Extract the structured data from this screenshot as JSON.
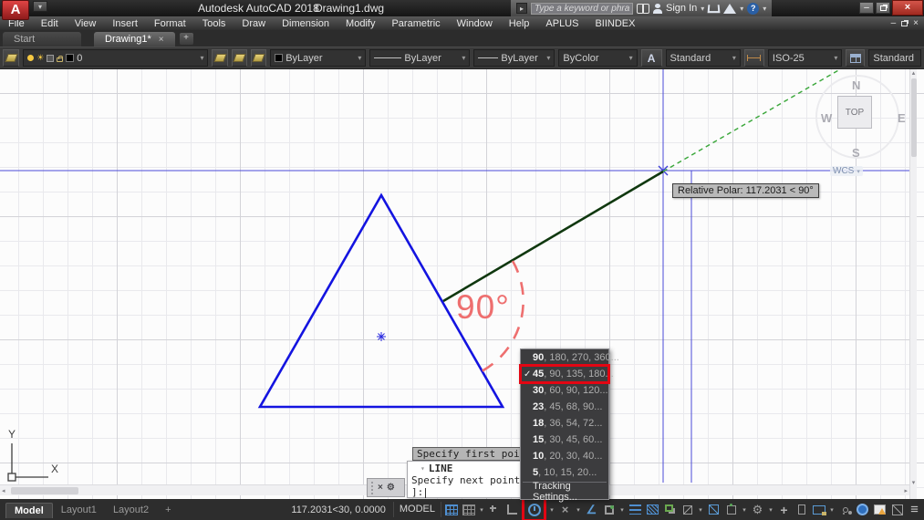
{
  "titlebar": {
    "app_initial": "A",
    "title_app": "Autodesk AutoCAD 2018",
    "title_doc": "Drawing1.dwg",
    "search_placeholder": "Type a keyword or phrase",
    "sign_in_label": "Sign In"
  },
  "menubar": {
    "items": [
      "File",
      "Edit",
      "View",
      "Insert",
      "Format",
      "Tools",
      "Draw",
      "Dimension",
      "Modify",
      "Parametric",
      "Window",
      "Help",
      "APLUS",
      "BIINDEX"
    ]
  },
  "filetabs": {
    "start_tab": "Start",
    "active_tab": "Drawing1*",
    "new_tab": "+"
  },
  "toolbar": {
    "layer_current": "0",
    "color": "ByLayer",
    "linetype": "ByLayer",
    "lineweight": "ByLayer",
    "plot_style": "ByColor",
    "text_style": "Standard",
    "dim_style": "ISO-25",
    "table_style": "Standard"
  },
  "canvas": {
    "polar_tooltip": "Relative Polar: 117.2031 < 90°",
    "angle_label": "90°",
    "viewcube": {
      "north": "N",
      "west": "W",
      "south": "S",
      "east": "E",
      "top": "TOP",
      "wcs": "WCS"
    },
    "ucs": {
      "x": "X",
      "y": "Y"
    }
  },
  "command": {
    "first_point_tooltip": "Specify first point:",
    "command_name": "LINE",
    "prompt_line": "Specify next point or [",
    "prompt_wrap": "]:"
  },
  "context_menu": {
    "items": [
      {
        "lead": "90",
        "rest": ", 180, 270, 360..."
      },
      {
        "lead": "45",
        "rest": ", 90, 135, 180...",
        "checked": "✓"
      },
      {
        "lead": "30",
        "rest": ", 60, 90, 120..."
      },
      {
        "lead": "23",
        "rest": ", 45, 68, 90..."
      },
      {
        "lead": "18",
        "rest": ", 36, 54, 72..."
      },
      {
        "lead": "15",
        "rest": ", 30, 45, 60..."
      },
      {
        "lead": "10",
        "rest": ", 20, 30, 40..."
      },
      {
        "lead": "5",
        "rest": ", 10, 15, 20..."
      }
    ],
    "tracking_settings": "Tracking Settings..."
  },
  "statusbar": {
    "model_tab": "Model",
    "layout1_tab": "Layout1",
    "layout2_tab": "Layout2",
    "new_layout": "+",
    "coordinates": "117.2031<30, 0.0000",
    "space_label": "MODEL"
  },
  "icons": {
    "caret_down": "▾",
    "caret_right": "▸",
    "caret_up": "▴",
    "caret_left": "◂",
    "close": "×",
    "minimize": "–",
    "question": "?",
    "angle": "∠",
    "sun": "☀",
    "gear": "⚙",
    "hamburger": "≡",
    "text_style_glyph": "A"
  },
  "colors": {
    "triangle_blue": "#1414e0",
    "crosshair_blue": "#4a4ad8",
    "rubberband_green": "#10380f",
    "tracking_green": "#3aa73a",
    "annotation_red": "#ee6f6f",
    "highlight_red": "#e30613",
    "status_icon_blue": "#4f8fd0"
  }
}
